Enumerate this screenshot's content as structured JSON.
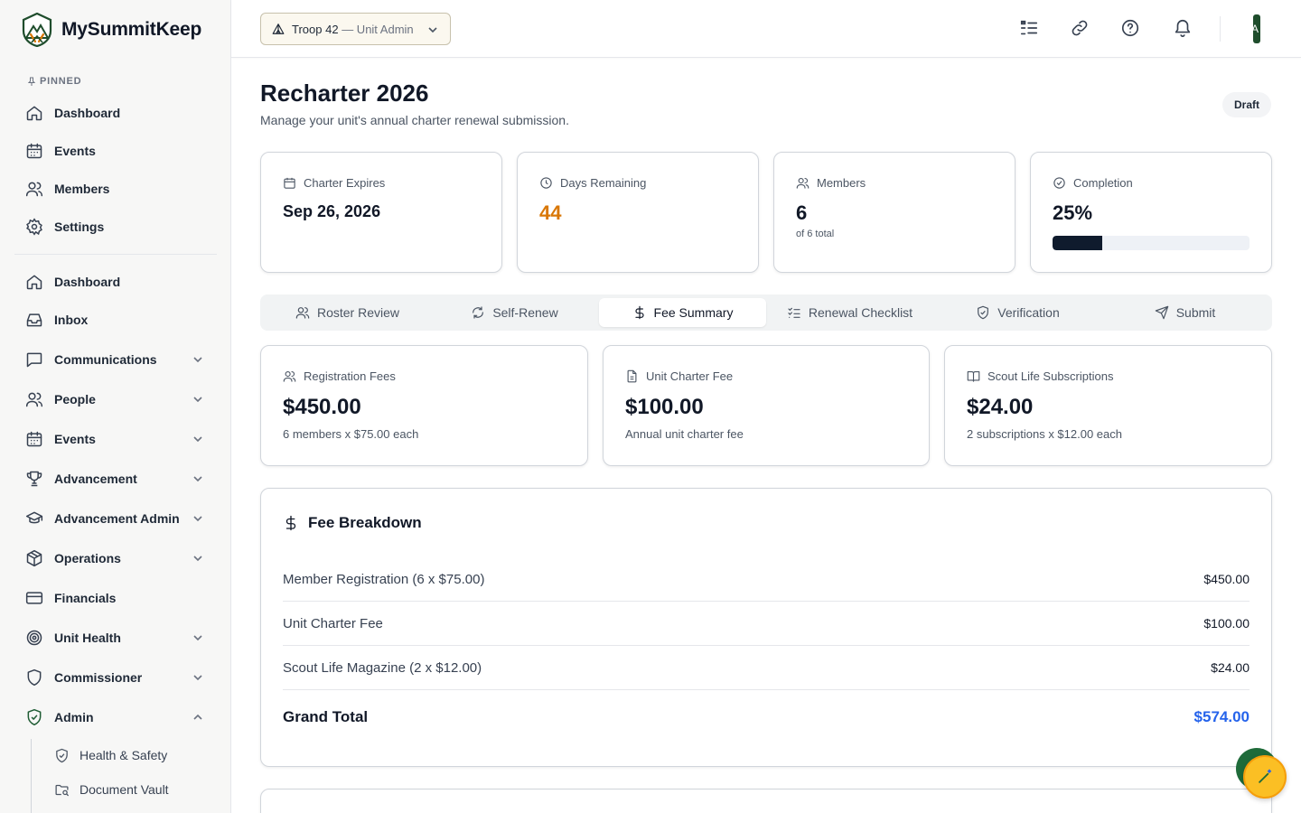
{
  "app": {
    "name": "MySummitKeep"
  },
  "sidebar": {
    "pinned_label": "PINNED",
    "pinned": [
      {
        "label": "Dashboard",
        "icon": "home-icon"
      },
      {
        "label": "Events",
        "icon": "calendar-icon"
      },
      {
        "label": "Members",
        "icon": "users-icon"
      },
      {
        "label": "Settings",
        "icon": "gear-icon"
      }
    ],
    "items": [
      {
        "label": "Dashboard",
        "icon": "home-icon",
        "expandable": false
      },
      {
        "label": "Inbox",
        "icon": "inbox-icon",
        "expandable": false
      },
      {
        "label": "Communications",
        "icon": "chat-icon",
        "expandable": true
      },
      {
        "label": "People",
        "icon": "users-icon",
        "expandable": true
      },
      {
        "label": "Events",
        "icon": "calendar-icon",
        "expandable": true
      },
      {
        "label": "Advancement",
        "icon": "trophy-icon",
        "expandable": true
      },
      {
        "label": "Advancement Admin",
        "icon": "graduation-cap-icon",
        "expandable": true
      },
      {
        "label": "Operations",
        "icon": "package-icon",
        "expandable": true
      },
      {
        "label": "Financials",
        "icon": "credit-card-icon",
        "expandable": false
      },
      {
        "label": "Unit Health",
        "icon": "target-icon",
        "expandable": true
      },
      {
        "label": "Commissioner",
        "icon": "shield-icon",
        "expandable": true
      },
      {
        "label": "Admin",
        "icon": "shield-check-icon",
        "expandable": true,
        "expanded": true
      }
    ],
    "admin_sub": [
      {
        "label": "Health & Safety",
        "icon": "shield-check-icon"
      },
      {
        "label": "Document Vault",
        "icon": "folder-search-icon"
      }
    ]
  },
  "topbar": {
    "unit": "Troop 42",
    "role": "— Unit Admin",
    "avatar_initial": "A"
  },
  "page": {
    "title": "Recharter 2026",
    "subtitle": "Manage your unit's annual charter renewal submission.",
    "status": "Draft"
  },
  "stats": {
    "charter_expires": {
      "label": "Charter Expires",
      "value": "Sep 26, 2026"
    },
    "days_remaining": {
      "label": "Days Remaining",
      "value": "44",
      "color": "#d97706"
    },
    "members": {
      "label": "Members",
      "value": "6",
      "note": "of 6 total"
    },
    "completion": {
      "label": "Completion",
      "value": "25%",
      "progress": 0.25
    }
  },
  "tabs": [
    {
      "label": "Roster Review",
      "icon": "users-icon"
    },
    {
      "label": "Self-Renew",
      "icon": "refresh-icon"
    },
    {
      "label": "Fee Summary",
      "icon": "dollar-icon",
      "active": true
    },
    {
      "label": "Renewal Checklist",
      "icon": "checklist-icon"
    },
    {
      "label": "Verification",
      "icon": "shield-check-icon"
    },
    {
      "label": "Submit",
      "icon": "send-icon"
    }
  ],
  "fees": {
    "registration": {
      "label": "Registration Fees",
      "amount": "$450.00",
      "desc": "6 members x $75.00 each"
    },
    "charter": {
      "label": "Unit Charter Fee",
      "amount": "$100.00",
      "desc": "Annual unit charter fee"
    },
    "scout_life": {
      "label": "Scout Life Subscriptions",
      "amount": "$24.00",
      "desc": "2 subscriptions x $12.00 each"
    }
  },
  "breakdown": {
    "title": "Fee Breakdown",
    "rows": [
      {
        "label": "Member Registration (6 x $75.00)",
        "amount": "$450.00"
      },
      {
        "label": "Unit Charter Fee",
        "amount": "$100.00"
      },
      {
        "label": "Scout Life Magazine (2 x $12.00)",
        "amount": "$24.00"
      }
    ],
    "total_label": "Grand Total",
    "total_amount": "$574.00",
    "total_color": "#2563eb"
  }
}
